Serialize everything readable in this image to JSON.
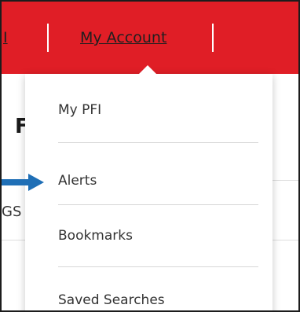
{
  "nav": {
    "clipped_link_text": "I",
    "account_link": "My Account"
  },
  "background": {
    "heading_fragment": "F",
    "subtext_fragment": "GS"
  },
  "dropdown": {
    "items": [
      {
        "label": "My PFI"
      },
      {
        "label": "Alerts"
      },
      {
        "label": "Bookmarks"
      },
      {
        "label": "Saved Searches"
      }
    ]
  },
  "colors": {
    "nav_bar": "#e01e26",
    "annotation_arrow": "#1f6fb6"
  },
  "icons": {
    "caret": "dropdown-caret-icon",
    "pointer": "callout-arrow-icon"
  }
}
